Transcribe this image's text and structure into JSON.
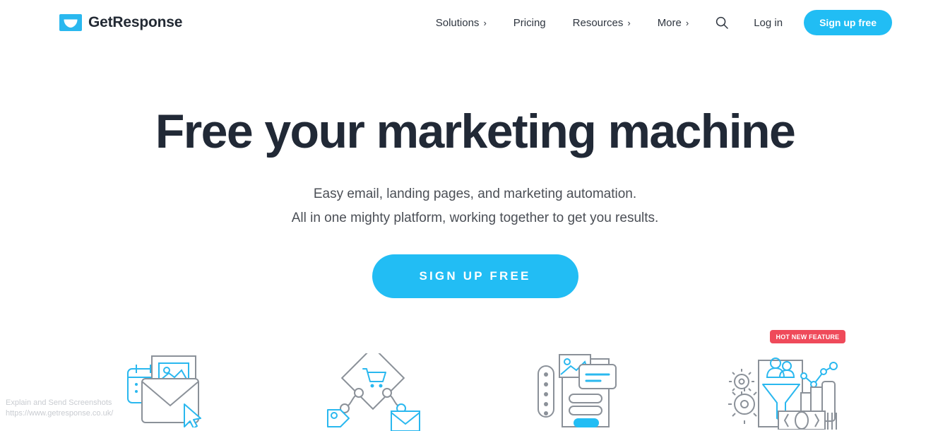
{
  "header": {
    "logo": {
      "text": "GetResponse",
      "icon": "envelope-icon",
      "color": "#2ab8ef"
    },
    "nav": [
      {
        "label": "Solutions",
        "caret": "›",
        "has_caret": true
      },
      {
        "label": "Pricing",
        "caret": "",
        "has_caret": false
      },
      {
        "label": "Resources",
        "caret": "›",
        "has_caret": true
      },
      {
        "label": "More",
        "caret": "›",
        "has_caret": true
      }
    ],
    "search_icon": "search-icon",
    "login_label": "Log in",
    "signup_label": "Sign up free",
    "accent_color": "#21bdf4"
  },
  "hero": {
    "title": "Free your marketing machine",
    "subtitle_line1": "Easy email, landing pages, and marketing automation.",
    "subtitle_line2": "All in one mighty platform, working together to get you results.",
    "cta_label": "SIGN UP FREE",
    "title_color": "#212936",
    "cta_color": "#22bdf4"
  },
  "illustrations": [
    {
      "name": "email-marketing-illustration"
    },
    {
      "name": "marketing-automation-illustration"
    },
    {
      "name": "landing-pages-illustration"
    },
    {
      "name": "conversion-funnel-illustration",
      "badge": "HOT NEW FEATURE",
      "badge_color": "#ef4a5a"
    }
  ],
  "watermark": {
    "line1": "Explain and Send Screenshots",
    "line2": "https://www.getresponse.co.uk/"
  }
}
